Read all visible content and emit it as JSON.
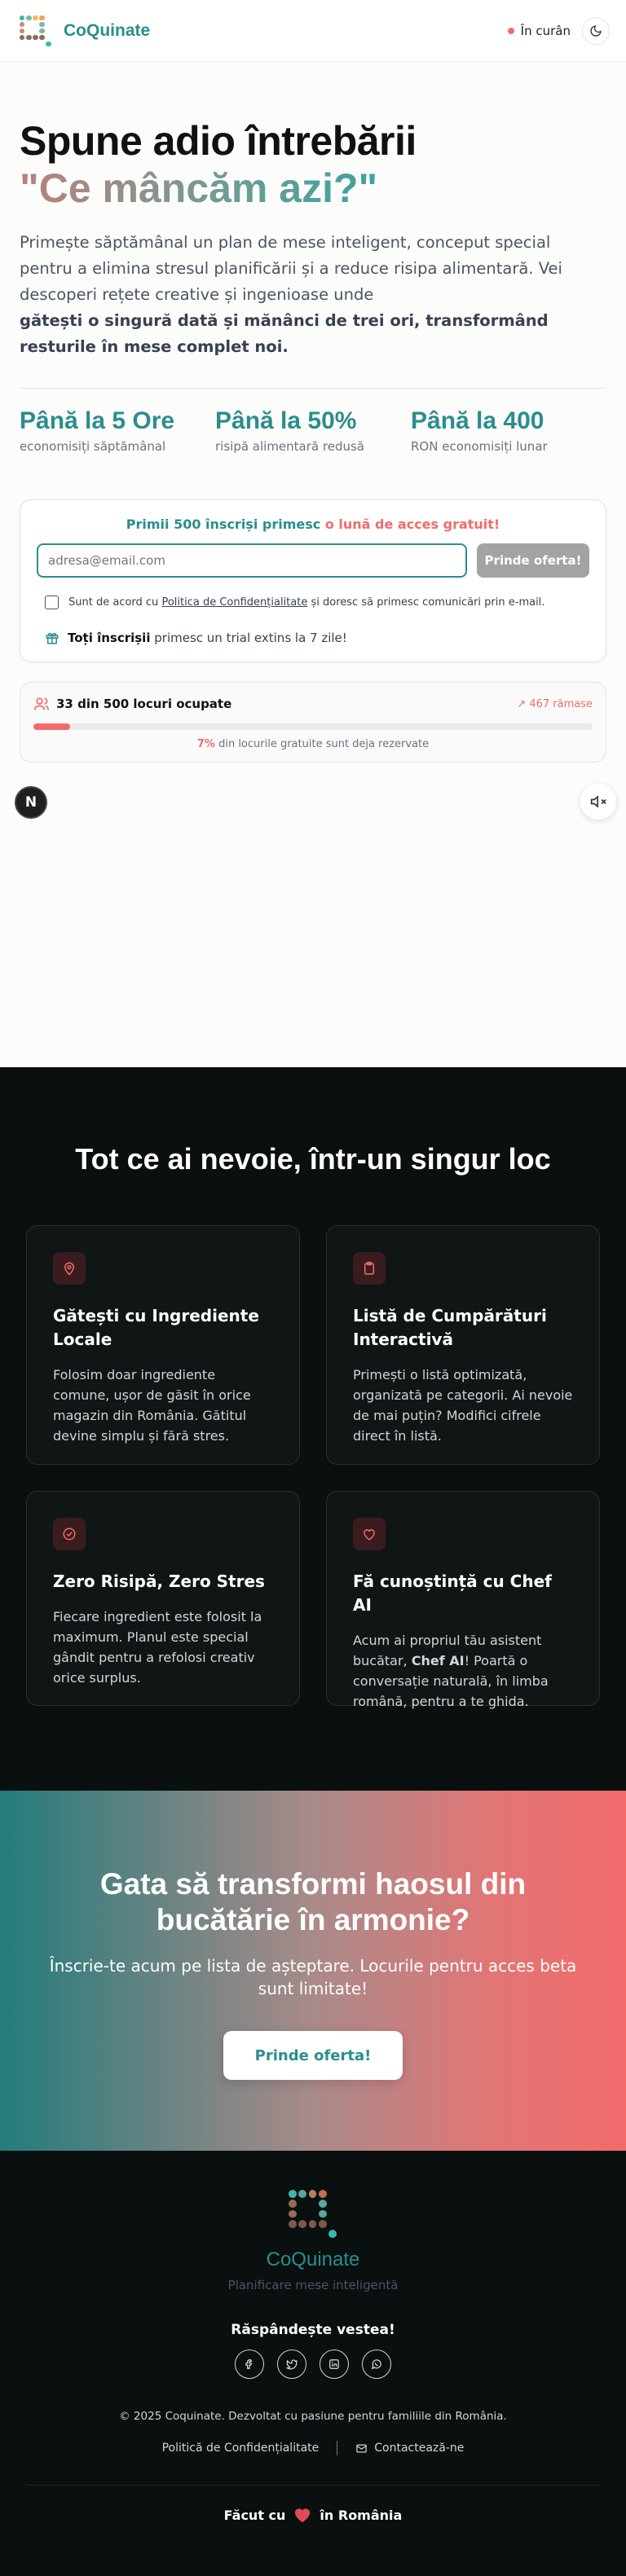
{
  "header": {
    "brand": "CoQuinate",
    "status": "În curân"
  },
  "hero": {
    "title_line1": "Spune adio întrebării",
    "title_line2": "\"Ce mâncăm azi?\"",
    "lead": "Primește săptămânal un plan de mese inteligent, conceput special pentru a elimina stresul planificării și a reduce risipa alimentară. Vei descoperi rețete creative și ingenioase unde",
    "lead_bold": "gătești o singură dată și mănânci de trei ori, transformând resturile în mese complet noi.",
    "stats": [
      {
        "value": "Până la 5 Ore",
        "label": "economisiți săptămânal"
      },
      {
        "value": "Până la 50%",
        "label": "risipă alimentară redusă"
      },
      {
        "value": "Până la 400",
        "label": "RON economisiți lunar"
      }
    ]
  },
  "signup": {
    "promo_part1": "Primii 500 înscriși primesc",
    "promo_part2": "o lună de acces gratuit!",
    "email_placeholder": "adresa@email.com",
    "submit_label": "Prinde oferta!",
    "consent_pre": "Sunt de acord cu",
    "consent_link": "Politica de Confidențialitate",
    "consent_post": "și doresc să primesc comunicări prin e-mail.",
    "trial_bold": "Toți înscrișii",
    "trial_rest": "primesc un trial extins la 7 zile!"
  },
  "progress": {
    "title": "33 din 500 locuri ocupate",
    "remaining": "467 rămase",
    "percent_label": "7%",
    "note": "din locurile gratuite sunt deja rezervate",
    "fraction": 0.066
  },
  "fab": {
    "letter": "N"
  },
  "features": {
    "title": "Tot ce ai nevoie, într-un singur loc",
    "items": [
      {
        "icon": "map-pin-icon",
        "name": "Gătești cu Ingrediente Locale",
        "desc": "Folosim doar ingrediente comune, ușor de găsit în orice magazin din România. Gătitul devine simplu și fără stres."
      },
      {
        "icon": "clipboard-icon",
        "name": "Listă de Cumpărături Interactivă",
        "desc": "Primești o listă optimizată, organizată pe categorii. Ai nevoie de mai puțin? Modifici cifrele direct în listă."
      },
      {
        "icon": "check-circle-icon",
        "name": "Zero Risipă, Zero Stres",
        "desc": "Fiecare ingredient este folosit la maximum. Planul este special gândit pentru a refolosi creativ orice surplus."
      },
      {
        "icon": "heart-icon",
        "name": "Fă cunoștință cu Chef AI",
        "desc_pre": "Acum ai propriul tău asistent bucătar,",
        "desc_bold": "Chef AI",
        "desc_post": "! Poartă o conversație naturală, în limba română, pentru a te ghida."
      }
    ]
  },
  "cta": {
    "title": "Gata să transformi haosul din bucătărie în armonie?",
    "subtitle": "Înscrie-te acum pe lista de așteptare. Locurile pentru acces beta sunt limitate!",
    "button": "Prinde oferta!"
  },
  "footer": {
    "brand": "CoQuinate",
    "tagline": "Planificare mese inteligentă",
    "share": "Răspândește vestea!",
    "socials": [
      "facebook-icon",
      "twitter-icon",
      "linkedin-icon",
      "whatsapp-icon"
    ],
    "copyright": "© 2025 Coquinate. Dezvoltat cu pasiune pentru familiile din România.",
    "privacy": "Politică de Confidențialitate",
    "contact": "Contactează-ne",
    "made_pre": "Făcut cu",
    "made_post": "în România"
  },
  "colors": {
    "teal": "#2b8d8f",
    "coral": "#f26b6b",
    "dark": "#0a0f0f"
  }
}
